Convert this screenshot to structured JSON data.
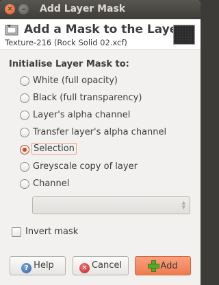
{
  "window": {
    "title": "Add Layer Mask"
  },
  "header": {
    "title": "Add a Mask to the Layer",
    "subtitle": "Texture-216 (Rock Solid 02.xcf)"
  },
  "options": {
    "section_label": "Initialise Layer Mask to:",
    "items": [
      {
        "label": "White (full opacity)",
        "checked": false
      },
      {
        "label": "Black (full transparency)",
        "checked": false
      },
      {
        "label": "Layer's alpha channel",
        "checked": false
      },
      {
        "label": "Transfer layer's alpha channel",
        "checked": false
      },
      {
        "label": "Selection",
        "checked": true
      },
      {
        "label": "Greyscale copy of layer",
        "checked": false
      },
      {
        "label": "Channel",
        "checked": false
      }
    ],
    "channel_combo": {
      "value": "",
      "enabled": false
    }
  },
  "invert": {
    "label": "Invert mask",
    "checked": false
  },
  "buttons": {
    "help_label": "Help",
    "cancel_label": "Cancel",
    "add_label": "Add"
  },
  "icons": {
    "close": "close-icon",
    "minimize": "minimize-icon",
    "layer_mask": "layer-mask-icon",
    "help": "help-icon",
    "cancel": "cancel-icon",
    "add": "add-icon"
  },
  "colors": {
    "accent": "#dd4814",
    "add_button": "#f07b50",
    "titlebar": "#3e3d39"
  }
}
